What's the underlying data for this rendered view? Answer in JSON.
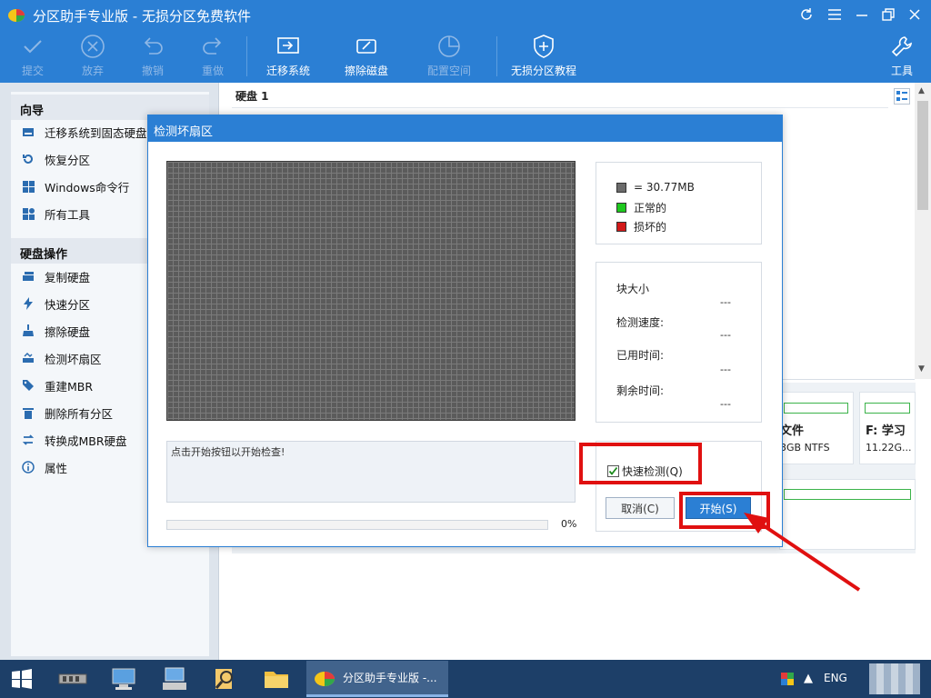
{
  "app": {
    "title": "分区助手专业版 - 无损分区免费软件"
  },
  "toolbar": {
    "submit": "提交",
    "discard": "放弃",
    "undo": "撤销",
    "redo": "重做",
    "migrate": "迁移系统",
    "wipe": "擦除磁盘",
    "allocate": "配置空间",
    "tutorial": "无损分区教程",
    "tools": "工具"
  },
  "sidebar": {
    "wizard_title": "向导",
    "wizard_items": [
      "迁移系统到固态硬盘",
      "恢复分区",
      "Windows命令行",
      "所有工具"
    ],
    "disk_title": "硬盘操作",
    "disk_items": [
      "复制硬盘",
      "快速分区",
      "擦除硬盘",
      "检测坏扇区",
      "重建MBR",
      "删除所有分区",
      "转换成MBR硬盘",
      "属性"
    ]
  },
  "main": {
    "disk_label": "硬盘 1",
    "partitions": [
      {
        "name": "文件",
        "info": "3GB NTFS"
      },
      {
        "name": "F: 学习",
        "info": "11.22G..."
      }
    ]
  },
  "dialog": {
    "title": "检测坏扇区",
    "legend": {
      "block_size": "= 30.77MB",
      "normal": "正常的",
      "bad": "损坏的"
    },
    "stats": {
      "block_size_label": "块大小",
      "block_size_value": "---",
      "speed_label": "检测速度:",
      "speed_value": "---",
      "elapsed_label": "已用时间:",
      "elapsed_value": "---",
      "remaining_label": "剩余时间:",
      "remaining_value": "---"
    },
    "message": "点击开始按钮以开始检查!",
    "progress_percent": "0%",
    "progress_value": 0,
    "quick_check": "快速检测(Q)",
    "quick_check_checked": true,
    "cancel": "取消(C)",
    "start": "开始(S)"
  },
  "taskbar": {
    "active_app": "分区助手专业版 -...",
    "language": "ENG"
  },
  "colors": {
    "accent": "#2b7fd4",
    "normal": "#1ec81e",
    "bad": "#d21919",
    "block": "#6b6b6b",
    "highlight": "#e01010"
  }
}
